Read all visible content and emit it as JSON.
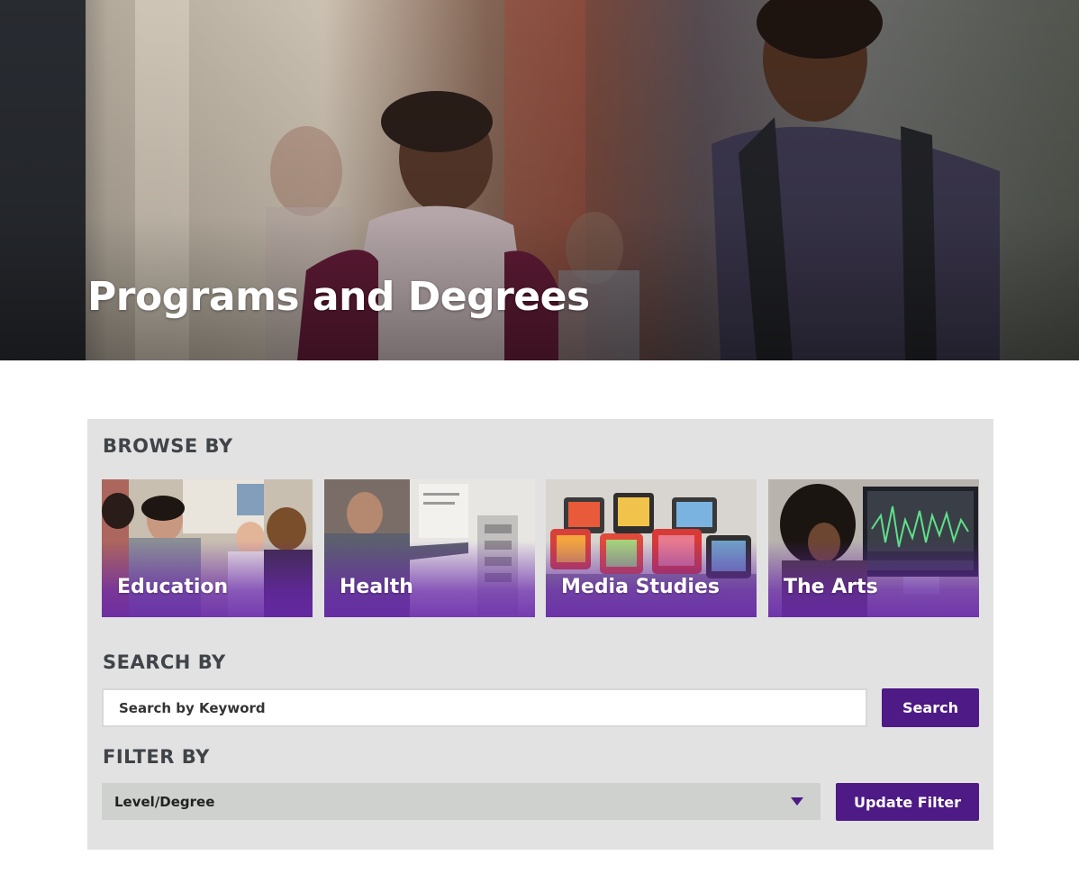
{
  "hero": {
    "title": "Programs and Degrees"
  },
  "browse": {
    "heading": "BROWSE BY",
    "tiles": [
      {
        "label": "Education"
      },
      {
        "label": "Health"
      },
      {
        "label": "Media Studies"
      },
      {
        "label": "The Arts"
      }
    ]
  },
  "search": {
    "heading": "SEARCH BY",
    "placeholder": "Search by Keyword",
    "button_label": "Search"
  },
  "filter": {
    "heading": "FILTER BY",
    "selected": "Level/Degree",
    "button_label": "Update Filter"
  },
  "colors": {
    "brand_purple": "#4e1a85",
    "panel_bg": "#e2e2e2",
    "select_bg": "#cfd1cf",
    "heading_text": "#404448"
  }
}
